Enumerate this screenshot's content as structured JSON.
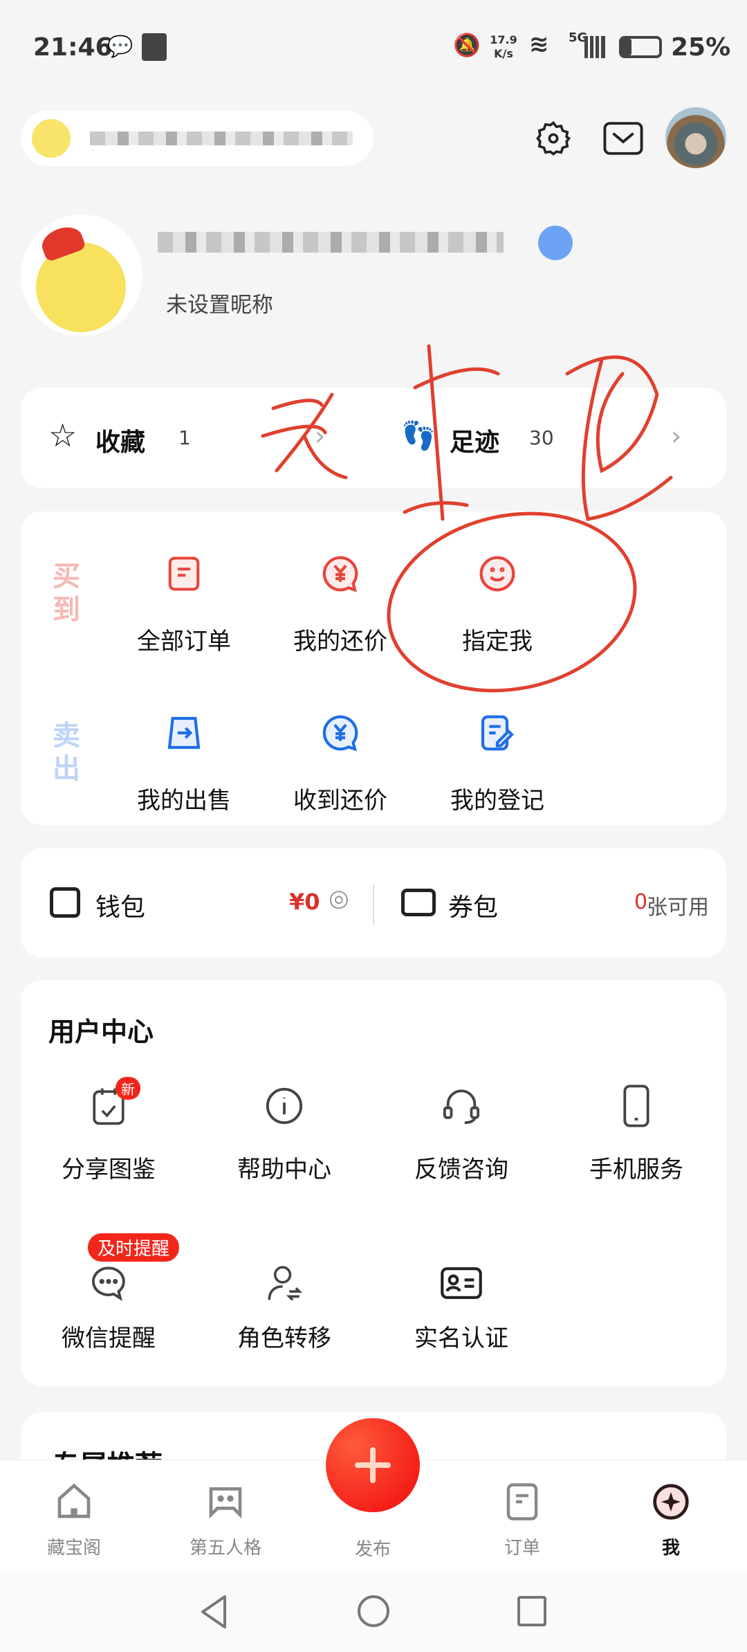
{
  "status": {
    "time": "21:46",
    "net_speed": "17.9 K/s",
    "network": "5G",
    "battery": "25%",
    "battery_level": 0.25
  },
  "profile": {
    "nickname_hint": "未设置昵称"
  },
  "quick": {
    "favorites_label": "收藏",
    "favorites_count": "1",
    "history_label": "足迹",
    "history_count": "30"
  },
  "orders": {
    "buy_tag": "买到",
    "sell_tag": "卖出",
    "buy": [
      {
        "label": "全部订单",
        "icon": "order-icon"
      },
      {
        "label": "我的还价",
        "icon": "yen-bubble-icon"
      },
      {
        "label": "指定我",
        "icon": "smile-icon"
      }
    ],
    "sell": [
      {
        "label": "我的出售",
        "icon": "sell-icon"
      },
      {
        "label": "收到还价",
        "icon": "yen-bubble-icon"
      },
      {
        "label": "我的登记",
        "icon": "register-icon"
      }
    ],
    "buy_color": "#e8453c",
    "sell_color": "#1f6fe5"
  },
  "wallet": {
    "wallet_label": "钱包",
    "balance": "¥0",
    "coupon_label": "券包",
    "coupon_count": "0",
    "coupon_suffix": "张可用"
  },
  "user_center": {
    "title": "用户中心",
    "items": [
      {
        "label": "分享图鉴",
        "badge": "新"
      },
      {
        "label": "帮助中心"
      },
      {
        "label": "反馈咨询"
      },
      {
        "label": "手机服务"
      },
      {
        "label": "微信提醒",
        "badge": "及时提醒"
      },
      {
        "label": "角色转移"
      },
      {
        "label": "实名认证"
      }
    ]
  },
  "recommend": {
    "title": "专属推荐"
  },
  "tabs": [
    {
      "label": "藏宝阁"
    },
    {
      "label": "第五人格"
    },
    {
      "label": "发布"
    },
    {
      "label": "订单"
    },
    {
      "label": "我",
      "active": true
    }
  ],
  "accent": "#f2271c"
}
